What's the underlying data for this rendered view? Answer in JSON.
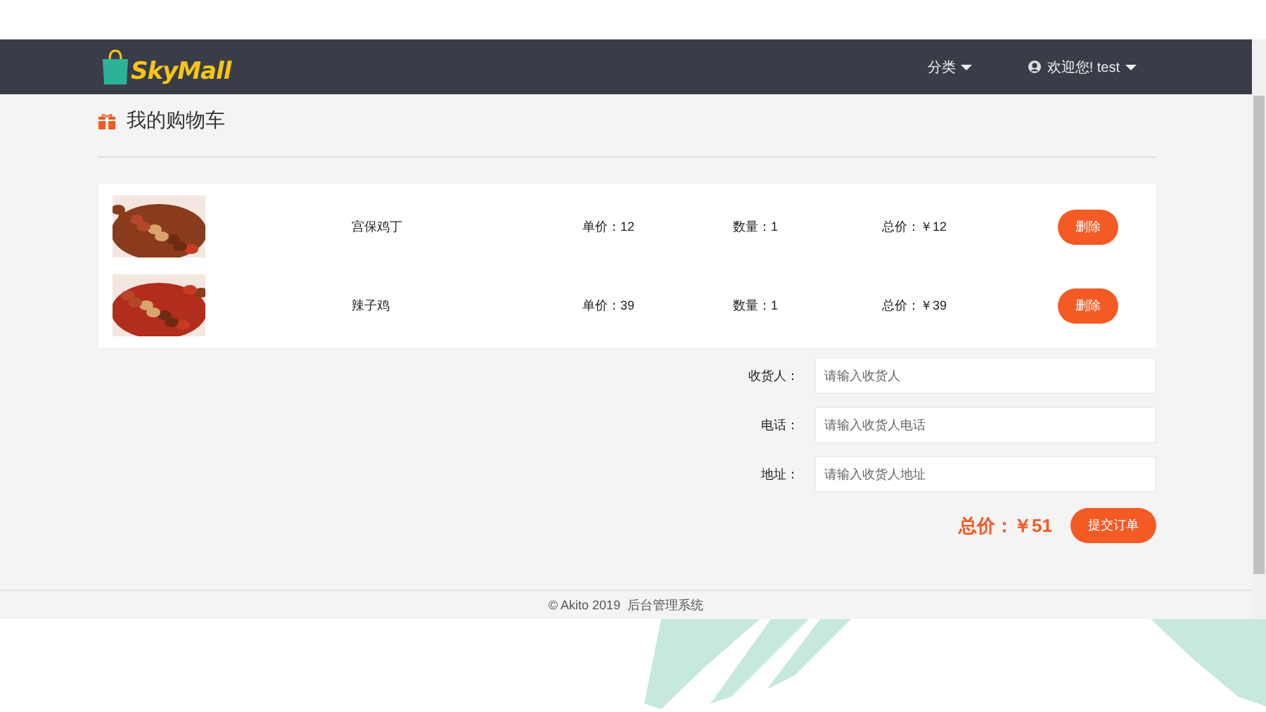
{
  "navbar": {
    "logo": "SkyMall",
    "menu": "分类",
    "user": "欢迎您! test"
  },
  "page_title": "我的购物车",
  "cart_items": [
    {
      "name": "宫保鸡丁",
      "unit_price": "单价：12",
      "quantity": "数量：1",
      "total": "总价：￥12",
      "delete_button": "删除"
    },
    {
      "name": "辣子鸡",
      "unit_price": "单价：39",
      "quantity": "数量：1",
      "total": "总价：￥39",
      "delete_button": "删除"
    }
  ],
  "order_form": {
    "fields": [
      {
        "label": "收货人：",
        "placeholder": "请输入收货人"
      },
      {
        "label": "电话：",
        "placeholder": "请输入收货人电话"
      },
      {
        "label": "地址：",
        "placeholder": "请输入收货人地址"
      }
    ],
    "total": "总价：￥51",
    "submit_button": "提交订单"
  },
  "footer": "© Akito 2019  后台管理系统"
}
